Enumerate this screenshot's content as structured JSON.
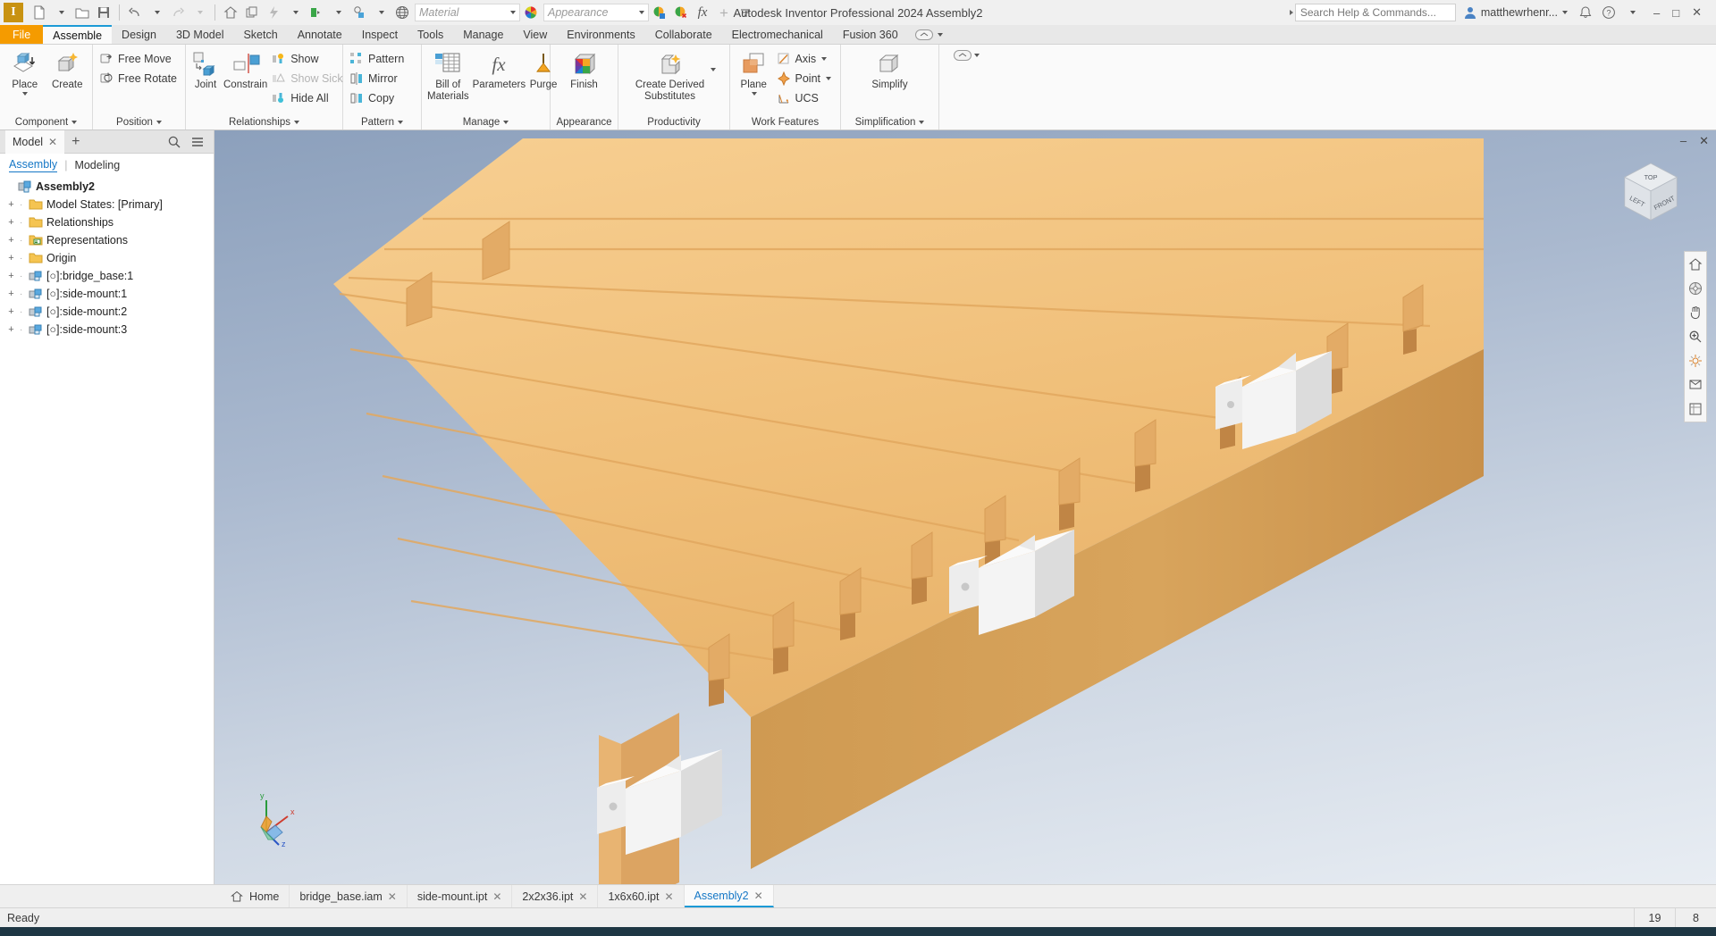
{
  "app": {
    "logo_letter": "I",
    "title": "Autodesk Inventor Professional 2024    Assembly2",
    "search_placeholder": "Search Help & Commands...",
    "user": "matthewrhenr...",
    "material_placeholder": "Material",
    "appearance_placeholder": "Appearance"
  },
  "quick_access": [
    {
      "name": "new-file-icon",
      "label": "New"
    },
    {
      "name": "open-file-icon",
      "label": "Open"
    },
    {
      "name": "save-icon",
      "label": "Save"
    },
    {
      "name": "undo-icon",
      "label": "Undo"
    },
    {
      "name": "redo-icon",
      "label": "Redo"
    },
    {
      "name": "home-icon",
      "label": "Home"
    },
    {
      "name": "return-icon",
      "label": "Return"
    },
    {
      "name": "update-icon",
      "label": "Update"
    },
    {
      "name": "select-icon",
      "label": "Select"
    },
    {
      "name": "appearance-browser-icon",
      "label": "Appearance"
    },
    {
      "name": "clear-appearance-icon",
      "label": "Clear Appearance Override"
    },
    {
      "name": "adjust-icon",
      "label": "Adjust"
    },
    {
      "name": "parameters-fx-icon",
      "label": "fx Parameters"
    },
    {
      "name": "add-icon",
      "label": "Add"
    },
    {
      "name": "more-icon",
      "label": "More"
    }
  ],
  "window_controls": {
    "minimize": "–",
    "maximize": "□",
    "close": "✕"
  },
  "ribbon": {
    "tabs": [
      {
        "label": "File",
        "style": "file"
      },
      {
        "label": "Assemble",
        "active": true
      },
      {
        "label": "Design"
      },
      {
        "label": "3D Model"
      },
      {
        "label": "Sketch"
      },
      {
        "label": "Annotate"
      },
      {
        "label": "Inspect"
      },
      {
        "label": "Tools"
      },
      {
        "label": "Manage"
      },
      {
        "label": "View"
      },
      {
        "label": "Environments"
      },
      {
        "label": "Collaborate"
      },
      {
        "label": "Electromechanical"
      },
      {
        "label": "Fusion 360"
      }
    ],
    "panels": [
      {
        "label": "Component",
        "has_dropdown": true,
        "big_buttons": [
          {
            "label": "Place",
            "icon": "place-component-icon",
            "dropdown": true
          },
          {
            "label": "Create",
            "icon": "create-component-icon",
            "dropdown": false
          }
        ],
        "small_buttons": []
      },
      {
        "label": "Position",
        "has_dropdown": true,
        "big_buttons": [],
        "small_buttons": [
          {
            "label": "Free Move",
            "icon": "free-move-icon"
          },
          {
            "label": "Free Rotate",
            "icon": "free-rotate-icon"
          }
        ]
      },
      {
        "label": "Relationships",
        "has_dropdown": true,
        "big_buttons": [
          {
            "label": "Joint",
            "icon": "joint-icon"
          },
          {
            "label": "Constrain",
            "icon": "constrain-icon"
          }
        ],
        "small_buttons": [
          {
            "label": "Show",
            "icon": "show-relationships-icon"
          },
          {
            "label": "Show Sick",
            "icon": "show-sick-icon",
            "disabled": true
          },
          {
            "label": "Hide All",
            "icon": "hide-all-icon"
          }
        ]
      },
      {
        "label": "Pattern",
        "has_dropdown": true,
        "big_buttons": [],
        "small_buttons": [
          {
            "label": "Pattern",
            "icon": "pattern-icon"
          },
          {
            "label": "Mirror",
            "icon": "mirror-icon"
          },
          {
            "label": "Copy",
            "icon": "copy-icon"
          }
        ]
      },
      {
        "label": "Manage",
        "has_dropdown": true,
        "big_buttons": [
          {
            "label": "Bill of Materials",
            "icon": "bill-of-materials-icon"
          },
          {
            "label": "Parameters",
            "icon": "parameters-icon"
          },
          {
            "label": "Purge",
            "icon": "purge-icon"
          }
        ],
        "small_buttons": []
      },
      {
        "label": "Appearance",
        "has_dropdown": false,
        "big_buttons": [
          {
            "label": "Finish",
            "icon": "finish-appearance-icon"
          }
        ],
        "small_buttons": []
      },
      {
        "label": "Productivity",
        "has_dropdown": false,
        "big_buttons": [
          {
            "label": "Create Derived Substitutes",
            "icon": "create-derived-substitutes-icon",
            "dropdown": true
          }
        ],
        "small_buttons": []
      },
      {
        "label": "Work Features",
        "has_dropdown": false,
        "big_buttons": [
          {
            "label": "Plane",
            "icon": "work-plane-icon",
            "dropdown": true
          }
        ],
        "small_buttons": [
          {
            "label": "Axis",
            "icon": "work-axis-icon",
            "dropdown": true
          },
          {
            "label": "Point",
            "icon": "work-point-icon",
            "dropdown": true
          },
          {
            "label": "UCS",
            "icon": "ucs-icon"
          }
        ]
      },
      {
        "label": "Simplification",
        "has_dropdown": true,
        "big_buttons": [
          {
            "label": "Simplify",
            "icon": "simplify-icon"
          }
        ],
        "small_buttons": []
      }
    ]
  },
  "browser": {
    "tab_label": "Model",
    "close_glyph": "✕",
    "add_glyph": "+",
    "search_icon": "search-icon",
    "menu_icon": "hamburger-menu-icon",
    "subtabs": [
      {
        "label": "Assembly",
        "active": true
      },
      {
        "label": "Modeling",
        "active": false
      }
    ],
    "divider": "|",
    "tree": [
      {
        "label": "Assembly2",
        "icon": "assembly-icon",
        "level": 0,
        "root": true,
        "expander": ""
      },
      {
        "label": "Model States: [Primary]",
        "icon": "folder-icon",
        "level": 1,
        "expander": "+"
      },
      {
        "label": "Relationships",
        "icon": "folder-icon",
        "level": 1,
        "expander": "+"
      },
      {
        "label": "Representations",
        "icon": "representations-icon",
        "level": 1,
        "expander": "+"
      },
      {
        "label": "Origin",
        "icon": "folder-icon",
        "level": 1,
        "expander": "+"
      },
      {
        "label": "[○]:bridge_base:1",
        "icon": "part-icon",
        "level": 1,
        "expander": "+"
      },
      {
        "label": "[○]:side-mount:1",
        "icon": "part-icon",
        "level": 1,
        "expander": "+"
      },
      {
        "label": "[○]:side-mount:2",
        "icon": "part-icon",
        "level": 1,
        "expander": "+"
      },
      {
        "label": "[○]:side-mount:3",
        "icon": "part-icon",
        "level": 1,
        "expander": "+"
      }
    ]
  },
  "viewport": {
    "restore_glyph": "–",
    "close_glyph": "✕",
    "navcube": {
      "top": "TOP",
      "left": "LEFT",
      "front": "FRONT"
    },
    "nav_tools": [
      {
        "name": "home-view-icon"
      },
      {
        "name": "full-navigation-wheel-icon"
      },
      {
        "name": "pan-icon"
      },
      {
        "name": "zoom-icon"
      },
      {
        "name": "orbit-icon"
      },
      {
        "name": "look-at-icon"
      },
      {
        "name": "view-face-icon"
      }
    ],
    "axis_labels": {
      "x": "x",
      "y": "y",
      "z": "z"
    },
    "colors": {
      "wood_top": "#f3c07a",
      "wood_side": "#d4a05a",
      "wood_end": "#e8b272",
      "bracket": "#f2f2f2",
      "bracket_shadow": "#cfcfcf",
      "background_top": "#8ca0bc",
      "background_bottom": "#e9eef4"
    }
  },
  "document_tabs": [
    {
      "label": "Home",
      "icon": "home-icon",
      "closable": false,
      "active": false
    },
    {
      "label": "bridge_base.iam",
      "closable": true,
      "active": false
    },
    {
      "label": "side-mount.ipt",
      "closable": true,
      "active": false
    },
    {
      "label": "2x2x36.ipt",
      "closable": true,
      "active": false
    },
    {
      "label": "1x6x60.ipt",
      "closable": true,
      "active": false
    },
    {
      "label": "Assembly2",
      "closable": true,
      "active": true
    }
  ],
  "status_bar": {
    "message": "Ready",
    "cell_1": "19",
    "cell_2": "8"
  }
}
